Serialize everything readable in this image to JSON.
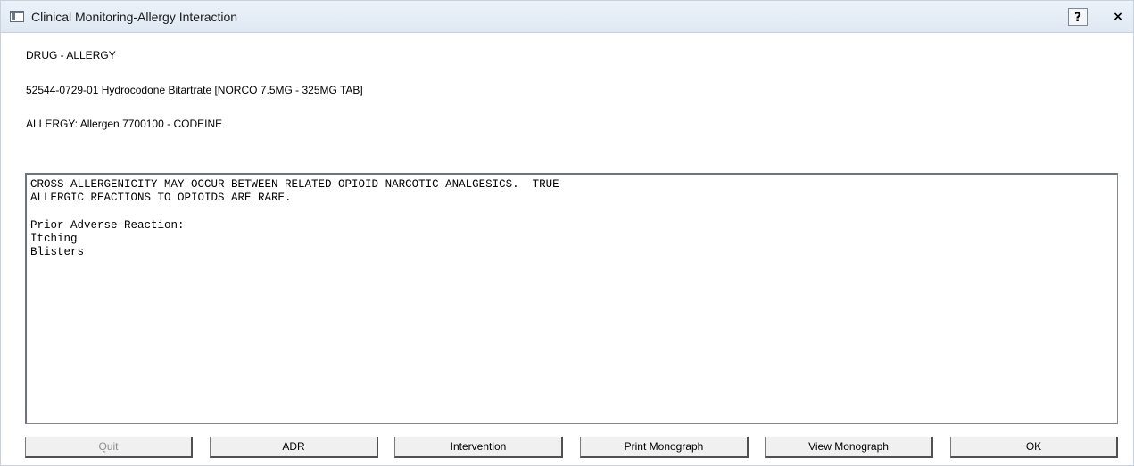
{
  "window": {
    "title": "Clinical Monitoring-Allergy Interaction",
    "help_label": "?",
    "close_label": "×"
  },
  "header": {
    "interaction_type": "DRUG - ALLERGY",
    "drug": "52544-0729-01 Hydrocodone Bitartrate [NORCO 7.5MG - 325MG TAB]",
    "allergy": "ALLERGY: Allergen 7700100 - CODEINE"
  },
  "details": {
    "text": "CROSS-ALLERGENICITY MAY OCCUR BETWEEN RELATED OPIOID NARCOTIC ANALGESICS.  TRUE\nALLERGIC REACTIONS TO OPIOIDS ARE RARE.\n\nPrior Adverse Reaction:\nItching\nBlisters"
  },
  "buttons": {
    "quit": "Quit",
    "adr": "ADR",
    "intervention": "Intervention",
    "print_monograph": "Print Monograph",
    "view_monograph": "View Monograph",
    "ok": "OK"
  }
}
